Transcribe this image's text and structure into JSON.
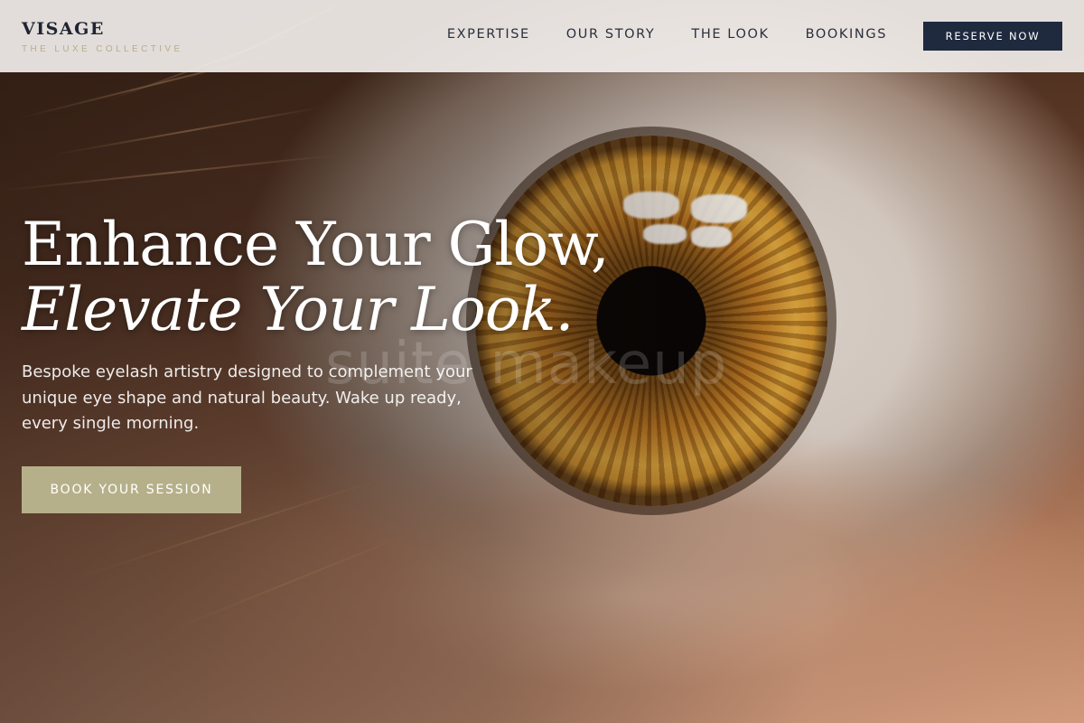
{
  "brand": {
    "name": "VISAGE",
    "tagline": "THE LUXE COLLECTIVE"
  },
  "nav": {
    "links": [
      {
        "label": "EXPERTISE"
      },
      {
        "label": "OUR STORY"
      },
      {
        "label": "THE LOOK"
      },
      {
        "label": "BOOKINGS"
      }
    ],
    "cta_label": "RESERVE NOW"
  },
  "hero": {
    "headline_line1": "Enhance Your Glow,",
    "headline_line2": "Elevate Your Look.",
    "watermark": "suite makeup",
    "subcopy": "Bespoke eyelash artistry designed to complement your unique eye shape and natural beauty. Wake up ready, every single morning.",
    "cta_label": "BOOK YOUR SESSION",
    "image_subject": "close-up-hazel-eye"
  },
  "colors": {
    "nav_bg": "#f0ece9",
    "brand_navy": "#1f2a3f",
    "tagline_gold": "#b8ad8a",
    "cta_sand": "#b6b08a",
    "headline_white": "#ffffff"
  }
}
